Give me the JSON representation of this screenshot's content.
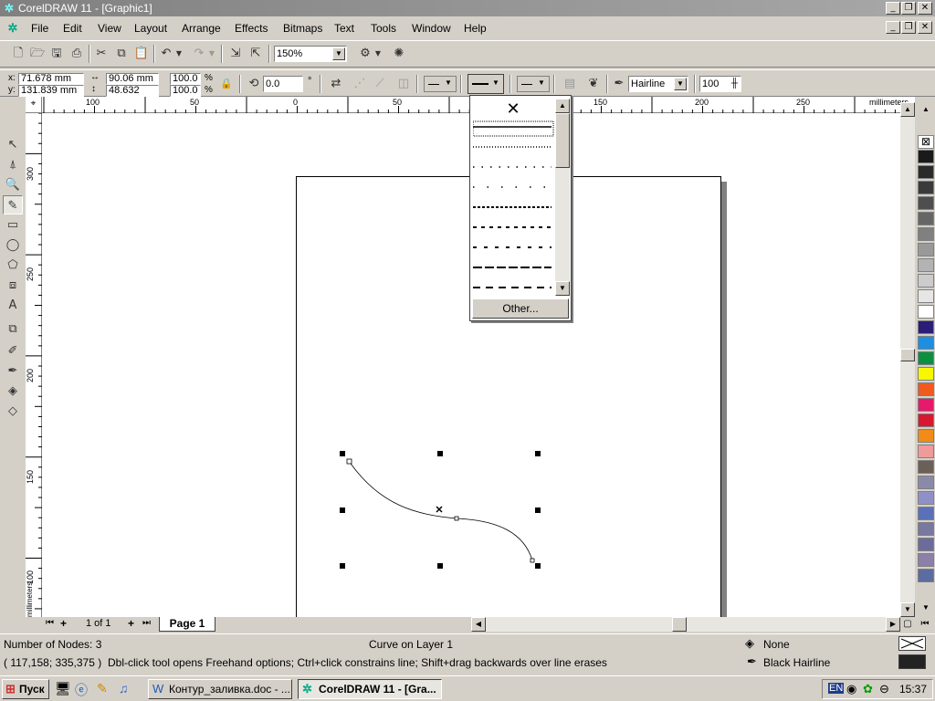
{
  "window": {
    "title": "CorelDRAW 11 - [Graphic1]",
    "controls": [
      "_",
      "❐",
      "✕"
    ]
  },
  "menu": [
    "File",
    "Edit",
    "View",
    "Layout",
    "Arrange",
    "Effects",
    "Bitmaps",
    "Text",
    "Tools",
    "Window",
    "Help"
  ],
  "standard_toolbar": {
    "zoom_value": "150%"
  },
  "property_bar": {
    "x": "71.678 mm",
    "y": "131.839 mm",
    "width": "90.06 mm",
    "height": "48.632 mm",
    "scale_x": "100.0",
    "scale_y": "100.0",
    "percent": "%",
    "angle": "0.0",
    "degree": "°",
    "outline_width": "Hairline",
    "smoothness": "100"
  },
  "rulers": {
    "unit": "millimeters",
    "h_ticks": [
      "100",
      "50",
      "0",
      "50",
      "100",
      "150",
      "200",
      "250"
    ],
    "v_ticks": [
      "300",
      "250",
      "200",
      "150",
      "100"
    ]
  },
  "line_style_dropdown": {
    "none_symbol": "✕",
    "other_label": "Other..."
  },
  "page_nav": {
    "page_count": "1 of 1",
    "page_tab": "Page 1"
  },
  "status": {
    "nodes": "Number of Nodes: 3",
    "object": "Curve on Layer 1",
    "coords": "( 117,158; 335,375 )",
    "hint": "Dbl-click tool opens Freehand options; Ctrl+click constrains line; Shift+drag backwards over line erases",
    "fill": "None",
    "outline": "Black  Hairline"
  },
  "taskbar": {
    "start": "Пуск",
    "task1": "Контур_заливка.doc - ...",
    "task2": "CorelDRAW 11 - [Gra...",
    "lang": "EN",
    "clock": "15:37"
  },
  "palette_colors": [
    "#1a1a1a",
    "#2a2a2a",
    "#3a3a3a",
    "#4e4e4e",
    "#666666",
    "#808080",
    "#999999",
    "#b3b3b3",
    "#cccccc",
    "#e6e6e6",
    "#ffffff",
    "#2a1e78",
    "#1e8ee0",
    "#0a9040",
    "#f7f700",
    "#f05a1e",
    "#e8186c",
    "#d81830",
    "#f08c18",
    "#f09a9a",
    "#6a6058",
    "#8a8aa8",
    "#9090c8",
    "#5a70b8",
    "#7878a0",
    "#6c6c9c",
    "#8a80a8",
    "#5c6ca0"
  ]
}
